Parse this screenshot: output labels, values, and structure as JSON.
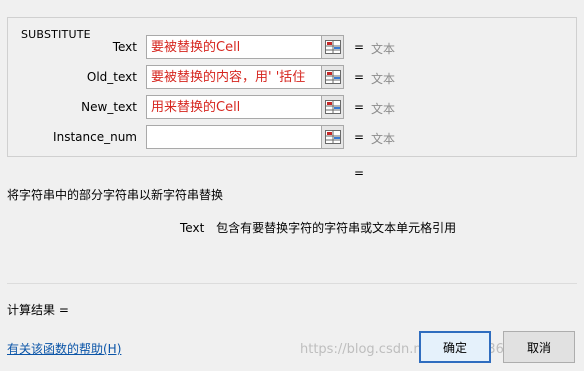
{
  "group": {
    "title": "SUBSTITUTE"
  },
  "args": [
    {
      "label": "Text",
      "value": "要被替换的Cell",
      "eq": "=",
      "result": "文本"
    },
    {
      "label": "Old_text",
      "value": "要被替换的内容，用' '括住",
      "eq": "=",
      "result": "文本"
    },
    {
      "label": "New_text",
      "value": "用来替换的Cell",
      "eq": "=",
      "result": "文本"
    },
    {
      "label": "Instance_num",
      "value": "",
      "eq": "=",
      "result": "文本"
    }
  ],
  "formula_eq": "=",
  "description": "将字符串中的部分字符串以新字符串替换",
  "param_help": {
    "name": "Text",
    "text": "包含有要替换字符的字符串或文本单元格引用"
  },
  "calc_result": "计算结果 =",
  "help_link": "有关该函数的帮助(H)",
  "buttons": {
    "ok": "确定",
    "cancel": "取消"
  },
  "watermark": "https://blog.csdn.net/weixin_36485923",
  "icons": {
    "ref": "range-select-icon"
  }
}
